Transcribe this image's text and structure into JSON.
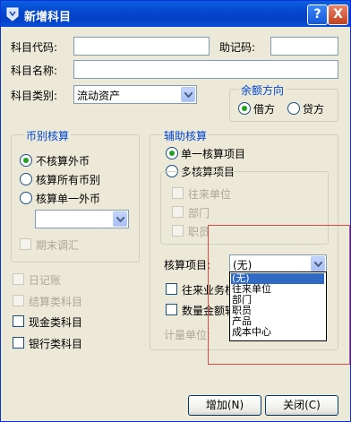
{
  "window": {
    "title": "新增科目",
    "help_btn": "?",
    "close_btn": "X"
  },
  "form": {
    "code_label": "科目代码:",
    "code_value": "",
    "mnemonic_label": "助记码:",
    "mnemonic_value": "",
    "name_label": "科目名称:",
    "name_value": "",
    "type_label": "科目类别:",
    "type_value": "流动资产"
  },
  "balance": {
    "legend": "余额方向",
    "debit": "借方",
    "credit": "贷方",
    "selected": "借方"
  },
  "currency": {
    "legend": "币别核算",
    "opt_none": "不核算外币",
    "opt_all": "核算所有币别",
    "opt_single": "核算单一外币",
    "currency_select": "",
    "period_end": "期末调汇"
  },
  "aux": {
    "legend": "辅助核算",
    "single": "单一核算项目",
    "multi": "多核算项目",
    "item_contacts": "往来单位",
    "item_dept": "部门",
    "item_staff": "职员",
    "project_label": "核算项目:",
    "project_value": "(无)",
    "contacts_business": "往来业务核算",
    "qty_amount": "数量金额辅助核算",
    "unit_label": "计量单位:",
    "dropdown_options": [
      "(无)",
      "往来单位",
      "部门",
      "职员",
      "产品",
      "成本中心"
    ]
  },
  "left_checks": {
    "journal": "日记账",
    "settlement": "结算类科目",
    "cash": "现金类科目",
    "bank": "银行类科目"
  },
  "buttons": {
    "add": "增加(N)",
    "close": "关闭(C)"
  }
}
